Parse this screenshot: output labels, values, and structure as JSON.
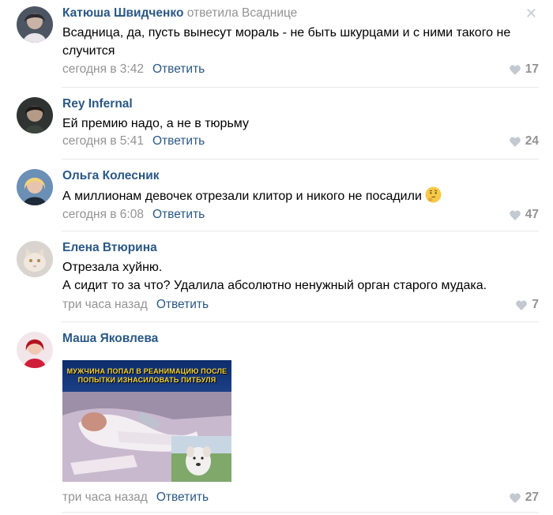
{
  "close_icon": "close-icon",
  "comments": [
    {
      "author": "Катюша Швидченко",
      "reply_to": "ответила Всаднице",
      "text": "Всадница, да, пусть вынесут мораль - не быть шкурцами и с ними такого не случится",
      "time": "сегодня в 3:42",
      "reply_label": "Ответить",
      "likes": "17"
    },
    {
      "author": "Rey Infernal",
      "text": "Ей премию надо, а не в тюрьму",
      "time": "сегодня в 5:41",
      "reply_label": "Ответить",
      "likes": "24"
    },
    {
      "author": "Ольга Колесник",
      "text": "А миллионам девочек отрезали клитор и никого не посадили",
      "emoji": "thinking-face-emoji",
      "time": "сегодня в 6:08",
      "reply_label": "Ответить",
      "likes": "47"
    },
    {
      "author": "Елена Втюрина",
      "text_line1": "Отрезала хуйню.",
      "text_line2": "А сидит то за что? Удалила абсолютно ненужный орган старого мудака.",
      "time": "три часа назад",
      "reply_label": "Ответить",
      "likes": "7"
    },
    {
      "author": "Маша Яковлева",
      "image_caption": "МУЖЧИНА ПОПАЛ В РЕАНИМАЦИЮ ПОСЛЕ ПОПЫТКИ ИЗНАСИЛОВАТЬ ПИТБУЛЯ",
      "time": "три часа назад",
      "reply_label": "Ответить",
      "likes": "27"
    }
  ],
  "colors": {
    "link": "#2a5885",
    "muted": "#939393",
    "divider": "#e7e8ec"
  }
}
